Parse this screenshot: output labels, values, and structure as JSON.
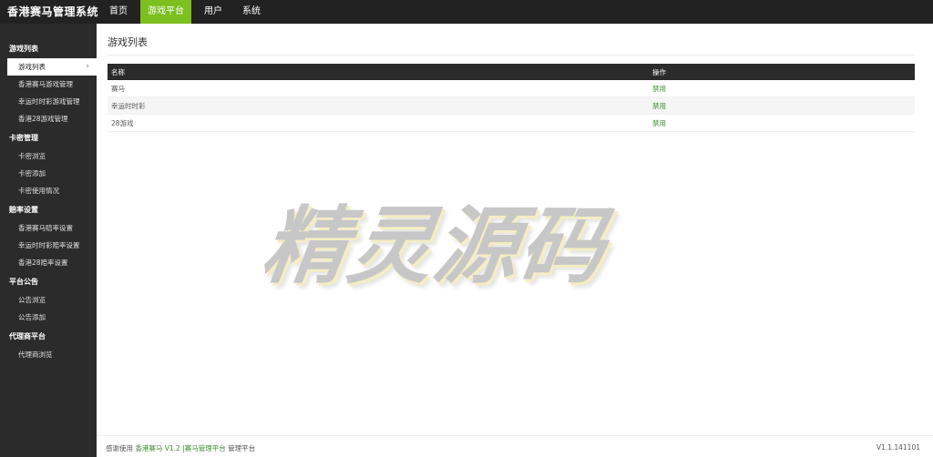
{
  "header": {
    "brand": "香港赛马管理系统",
    "nav": [
      {
        "label": "首页"
      },
      {
        "label": "游戏平台"
      },
      {
        "label": "用户"
      },
      {
        "label": "系统"
      }
    ]
  },
  "sidebar": {
    "groups": [
      {
        "title": "游戏列表",
        "items": [
          "游戏列表",
          "香港赛马游戏管理",
          "幸运时时彩游戏管理",
          "香港28游戏管理"
        ]
      },
      {
        "title": "卡密管理",
        "items": [
          "卡密浏览",
          "卡密添加",
          "卡密使用情况"
        ]
      },
      {
        "title": "赔率设置",
        "items": [
          "香港赛马赔率设置",
          "幸运时时彩赔率设置",
          "香港28赔率设置"
        ]
      },
      {
        "title": "平台公告",
        "items": [
          "公告浏览",
          "公告添加"
        ]
      },
      {
        "title": "代理商平台",
        "items": [
          "代理商浏览"
        ]
      }
    ]
  },
  "main": {
    "title": "游戏列表",
    "table": {
      "headers": [
        "名称",
        "操作"
      ],
      "rows": [
        {
          "name": "赛马",
          "action": "禁用"
        },
        {
          "name": "幸运时时彩",
          "action": "禁用"
        },
        {
          "name": "28游戏",
          "action": "禁用"
        }
      ]
    }
  },
  "watermark": "精灵源码",
  "footer": {
    "prefix": "感谢使用",
    "product": "香港赛马 V1.2 |赛马管理平台",
    "suffix": "管理平台",
    "version": "V1.1.141101"
  },
  "colors": {
    "topbar": "#222222",
    "active_nav": "#7cbf1f",
    "sidebar": "#2b2b2b",
    "action_link": "#3c8d2f"
  }
}
